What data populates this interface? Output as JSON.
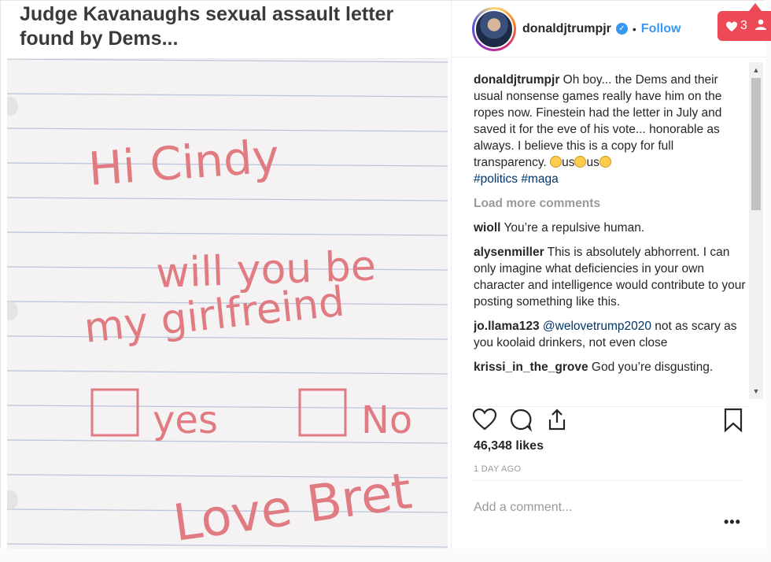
{
  "image": {
    "headline": "Judge Kavanaughs sexual assault letter found by Dems...",
    "note_lines": [
      "Hi Cindy",
      "will you be",
      "my girlfreind",
      "yes",
      "No",
      "Love Bret"
    ]
  },
  "header": {
    "username": "donaldjtrumpjr",
    "verified_icon": "verified-badge-icon",
    "separator": "•",
    "follow_label": "Follow"
  },
  "caption": {
    "username": "donaldjtrumpjr",
    "text": "Oh boy... the Dems and their usual nonsense games really have him on the ropes now. Finestein had the letter in July and saved it for the eve of his vote... honorable as always. I believe this is a copy for full transparency.",
    "emoji_text": [
      "us",
      "us"
    ],
    "hashtags": [
      "#politics",
      "#maga"
    ]
  },
  "load_more": "Load more comments",
  "comments": [
    {
      "username": "wioll",
      "mention": "",
      "text": "You’re a repulsive human."
    },
    {
      "username": "alysenmiller",
      "mention": "",
      "text": "This is absolutely abhorrent. I can only imagine what deficiencies in your own character and intelligence would contribute to your posting something like this."
    },
    {
      "username": "jo.llama123",
      "mention": "@welovetrump2020",
      "text": "not as scary as you koolaid drinkers, not even close"
    },
    {
      "username": "krissi_in_the_grove",
      "mention": "",
      "text": "God you’re disgusting."
    }
  ],
  "actions": {
    "like_icon": "heart-icon",
    "comment_icon": "comment-bubble-icon",
    "share_icon": "share-icon",
    "save_icon": "bookmark-icon"
  },
  "likes": "46,348 likes",
  "timestamp": "1 DAY AGO",
  "add_comment_placeholder": "Add a comment...",
  "more_label": "•••",
  "notification": {
    "count": "3",
    "icon": "heart-icon"
  },
  "colors": {
    "link": "#3897f0",
    "hashtag": "#003569",
    "muted": "#999999",
    "notification": "#ed4956",
    "ink": "#e2848a"
  }
}
